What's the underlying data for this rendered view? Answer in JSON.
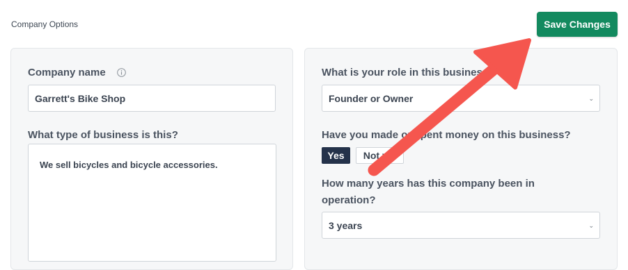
{
  "header": {
    "title": "Company Options",
    "save_label": "Save Changes"
  },
  "left": {
    "company_name_label": "Company name",
    "company_name_value": "Garrett's Bike Shop",
    "business_type_label": "What type of business is this?",
    "business_type_value": "We sell bicycles and bicycle accessories."
  },
  "right": {
    "role_label": "What is your role in this business?",
    "role_value": "Founder or Owner",
    "made_money_label": "Have you made or spent money on this business?",
    "yes_label": "Yes",
    "no_label": "Not yet",
    "years_label_line1": "How many years has this company been in",
    "years_label_line2": "operation?",
    "years_value": "3 years"
  },
  "annotation": {
    "arrow_color": "#f5564e"
  }
}
